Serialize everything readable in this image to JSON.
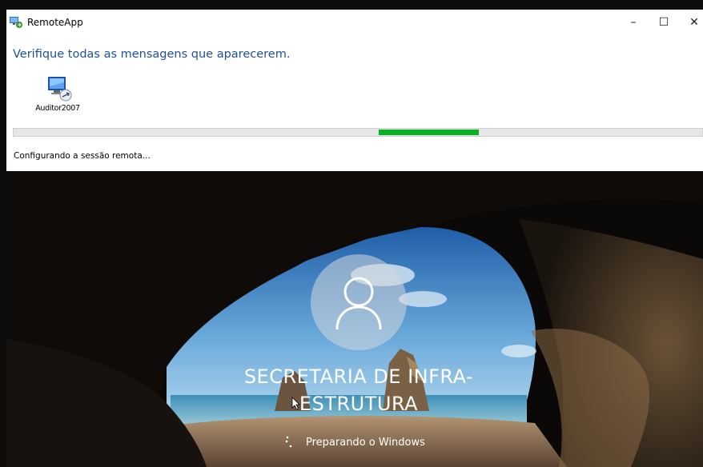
{
  "window": {
    "title": "RemoteApp",
    "minimize_label": "–",
    "maximize_label": "☐",
    "close_label": "✕"
  },
  "dialog": {
    "heading": "Verifique todas as mensagens que aparecerem.",
    "program": {
      "label": "Auditor2007",
      "icon": "remote-program-icon"
    },
    "progress": {
      "indeterminate": true,
      "segment_start": 0.53,
      "segment_length": 0.145,
      "accent": "#06b025"
    },
    "status": "Configurando a sessão remota..."
  },
  "lock_screen": {
    "user_name": "SECRETARIA DE INFRA-ESTRUTURA",
    "status": "Preparando o Windows"
  }
}
